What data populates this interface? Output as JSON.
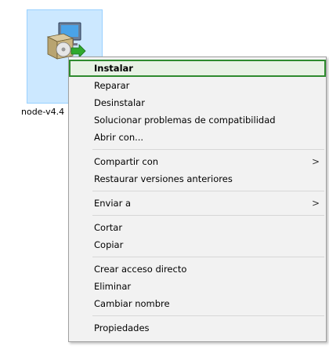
{
  "file": {
    "label": "node-v4.4",
    "icon": "installer-package-icon"
  },
  "menu": {
    "groups": [
      {
        "items": [
          {
            "label": "Instalar",
            "default": true,
            "highlight": true
          },
          {
            "label": "Reparar"
          },
          {
            "label": "Desinstalar"
          },
          {
            "label": "Solucionar problemas de compatibilidad"
          },
          {
            "label": "Abrir con..."
          }
        ]
      },
      {
        "items": [
          {
            "label": "Compartir con",
            "submenu": true
          },
          {
            "label": "Restaurar versiones anteriores"
          }
        ]
      },
      {
        "items": [
          {
            "label": "Enviar a",
            "submenu": true
          }
        ]
      },
      {
        "items": [
          {
            "label": "Cortar"
          },
          {
            "label": "Copiar"
          }
        ]
      },
      {
        "items": [
          {
            "label": "Crear acceso directo"
          },
          {
            "label": "Eliminar"
          },
          {
            "label": "Cambiar nombre"
          }
        ]
      },
      {
        "items": [
          {
            "label": "Propiedades"
          }
        ]
      }
    ],
    "submenu_glyph": ">"
  }
}
